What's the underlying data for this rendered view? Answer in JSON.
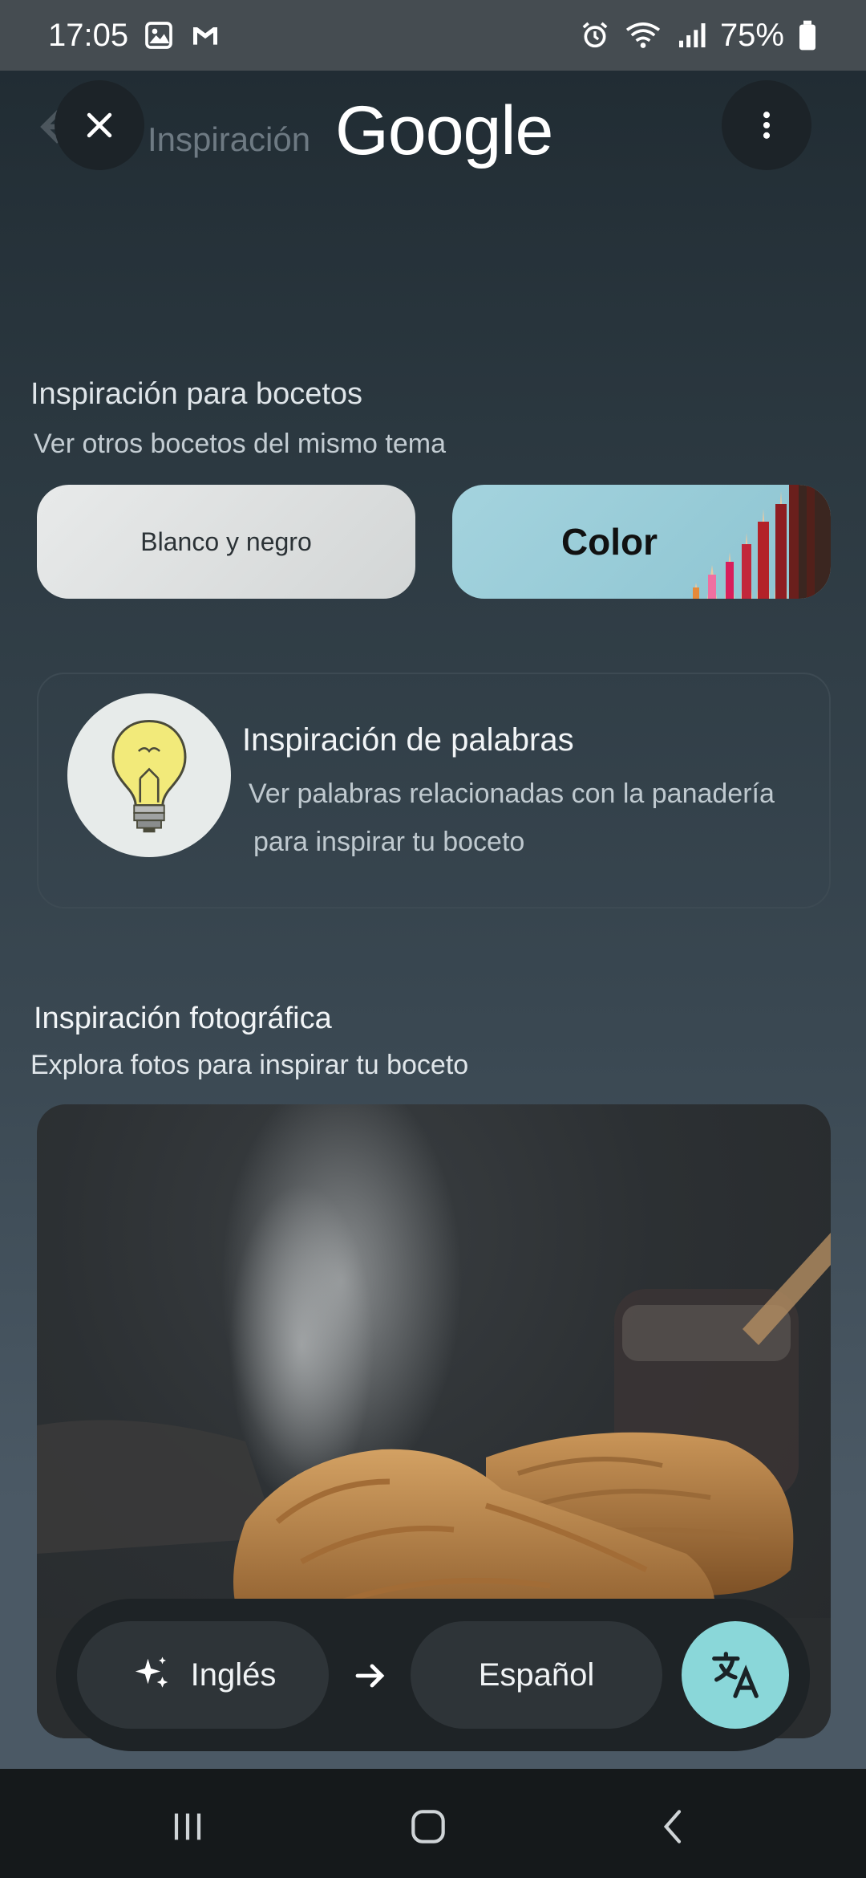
{
  "status_bar": {
    "time": "17:05",
    "battery": "75%",
    "icons_left": [
      "gallery-icon",
      "gmail-icon"
    ],
    "icons_right": [
      "alarm-icon",
      "wifi-icon",
      "signal-icon",
      "battery-icon"
    ]
  },
  "header": {
    "ghost_title": "Inspiración",
    "logo": "Google",
    "close_icon": "close-icon",
    "menu_icon": "more-vert-icon"
  },
  "sketch_inspiration": {
    "title": "Inspiración para bocetos",
    "subtitle": "Ver otros bocetos del mismo tema",
    "options": [
      {
        "label": "Blanco y negro"
      },
      {
        "label": "Color"
      }
    ]
  },
  "word_inspiration": {
    "title": "Inspiración de palabras",
    "desc_line1": "Ver palabras relacionadas con la panadería",
    "desc_line2": "para inspirar tu boceto"
  },
  "photo_inspiration": {
    "title": "Inspiración fotográfica",
    "subtitle": "Explora fotos para inspirar tu boceto"
  },
  "translate": {
    "source": "Inglés",
    "target": "Español",
    "accent": "#8ad7d9"
  }
}
